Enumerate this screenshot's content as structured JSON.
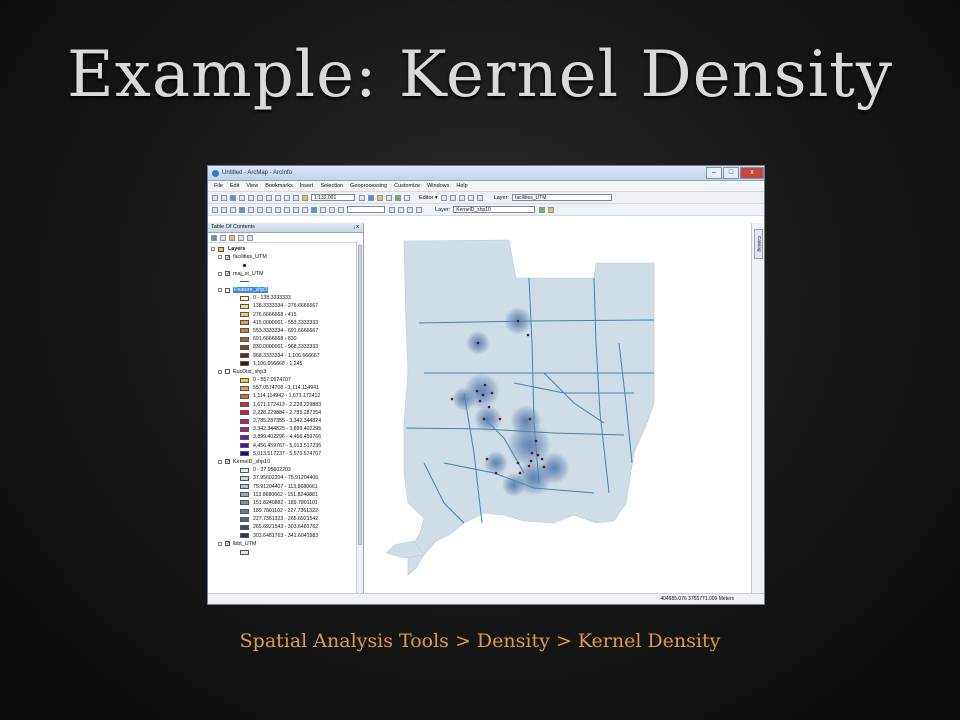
{
  "slide": {
    "title": "Example: Kernel Density",
    "caption": "Spatial Analysis Tools > Density > Kernel Density"
  },
  "window": {
    "title": "Untitled - ArcMap - ArcInfo",
    "menu": [
      "File",
      "Edit",
      "View",
      "Bookmarks",
      "Insert",
      "Selection",
      "Geoprocessing",
      "Customize",
      "Windows",
      "Help"
    ],
    "scale_value": "1:132,001",
    "editor_label": "Editor ▾",
    "layer_label": "Layer:",
    "layer_select_top": "facilities_UTM",
    "layer_select_bottom": "KernelD_shp10",
    "close_glyph": "x",
    "restore_glyph": "□",
    "min_glyph": "–"
  },
  "toc": {
    "title": "Table Of Contents",
    "pin": "ⱼ x",
    "root": "Layers",
    "layers": [
      {
        "name": "facilities_UTM",
        "checked": true,
        "legend": [
          {
            "label": "",
            "color": "#000000",
            "type": "dot"
          }
        ]
      },
      {
        "name": "maj_st_UTM",
        "checked": true,
        "legend": [
          {
            "label": "",
            "color": "#3b5fa8",
            "type": "line"
          }
        ]
      },
      {
        "name": "Feature_shp3",
        "checked": false,
        "selected": true,
        "legend": [
          {
            "label": "0 - 138.3333333",
            "color": "#fff7a8"
          },
          {
            "label": "138.3333334 - 276.6666667",
            "color": "#f7e27a"
          },
          {
            "label": "276.6666668 - 415",
            "color": "#f0c85a"
          },
          {
            "label": "415.0000001 - 553.3333333",
            "color": "#e0a54a"
          },
          {
            "label": "553.3333334 - 691.6666667",
            "color": "#c8823a"
          },
          {
            "label": "691.6666668 - 830",
            "color": "#a8602c"
          },
          {
            "label": "830.0000001 - 968.3333333",
            "color": "#884020"
          },
          {
            "label": "968.3333334 - 1,106.666667",
            "color": "#6a2614"
          },
          {
            "label": "1,106.666668 - 1,245",
            "color": "#4a120a"
          }
        ]
      },
      {
        "name": "EucDist_shp3",
        "checked": false,
        "legend": [
          {
            "label": "0 - 557.0574707",
            "color": "#f5c242"
          },
          {
            "label": "557.0574708 - 1,114.114941",
            "color": "#f0962e"
          },
          {
            "label": "1,114.114942 - 1,671.172412",
            "color": "#e8602a"
          },
          {
            "label": "1,671.172413 - 2,228.229883",
            "color": "#dc2c2c"
          },
          {
            "label": "2,228.229884 - 2,785.287354",
            "color": "#d01c52"
          },
          {
            "label": "2,785.287355 - 3,342.344824",
            "color": "#c01878"
          },
          {
            "label": "3,342.344825 - 3,899.402295",
            "color": "#a8189a"
          },
          {
            "label": "3,899.402296 - 4,456.459766",
            "color": "#7c14b0"
          },
          {
            "label": "4,456.459767 - 5,013.517236",
            "color": "#4a10b8"
          },
          {
            "label": "5,013.517237 - 5,570.574707",
            "color": "#1a0cb0"
          }
        ]
      },
      {
        "name": "KernelD_shp10",
        "checked": true,
        "legend": [
          {
            "label": "0 - 37.95602203",
            "color": "#dfe9f0"
          },
          {
            "label": "37.95602204 - 75.91204406",
            "color": "#c5d6e4"
          },
          {
            "label": "75.91204407 - 113.8680661",
            "color": "#a9c1d6"
          },
          {
            "label": "113.8680662 - 151.8240881",
            "color": "#8eaac8"
          },
          {
            "label": "151.8240882 - 189.7801101",
            "color": "#7493b8"
          },
          {
            "label": "189.7801102 - 227.7361322",
            "color": "#5c7ca6"
          },
          {
            "label": "227.7361323 - 265.6921542",
            "color": "#466593"
          },
          {
            "label": "265.6921543 - 303.6481762",
            "color": "#33507e"
          },
          {
            "label": "303.6481763 - 341.6041983",
            "color": "#223b66"
          }
        ]
      },
      {
        "name": "lbbt_UTM",
        "checked": true,
        "legend": [
          {
            "label": "",
            "color": "#e8dff2"
          }
        ]
      }
    ]
  },
  "catalog_tab": "Catalog",
  "status": {
    "coords": "404985.076  3755771.009 Meters"
  },
  "map": {
    "land_color": "#cfdde6",
    "road_color": "#3a86b4",
    "density_color": "#5a7fb0",
    "point_color": "#6a1030"
  }
}
